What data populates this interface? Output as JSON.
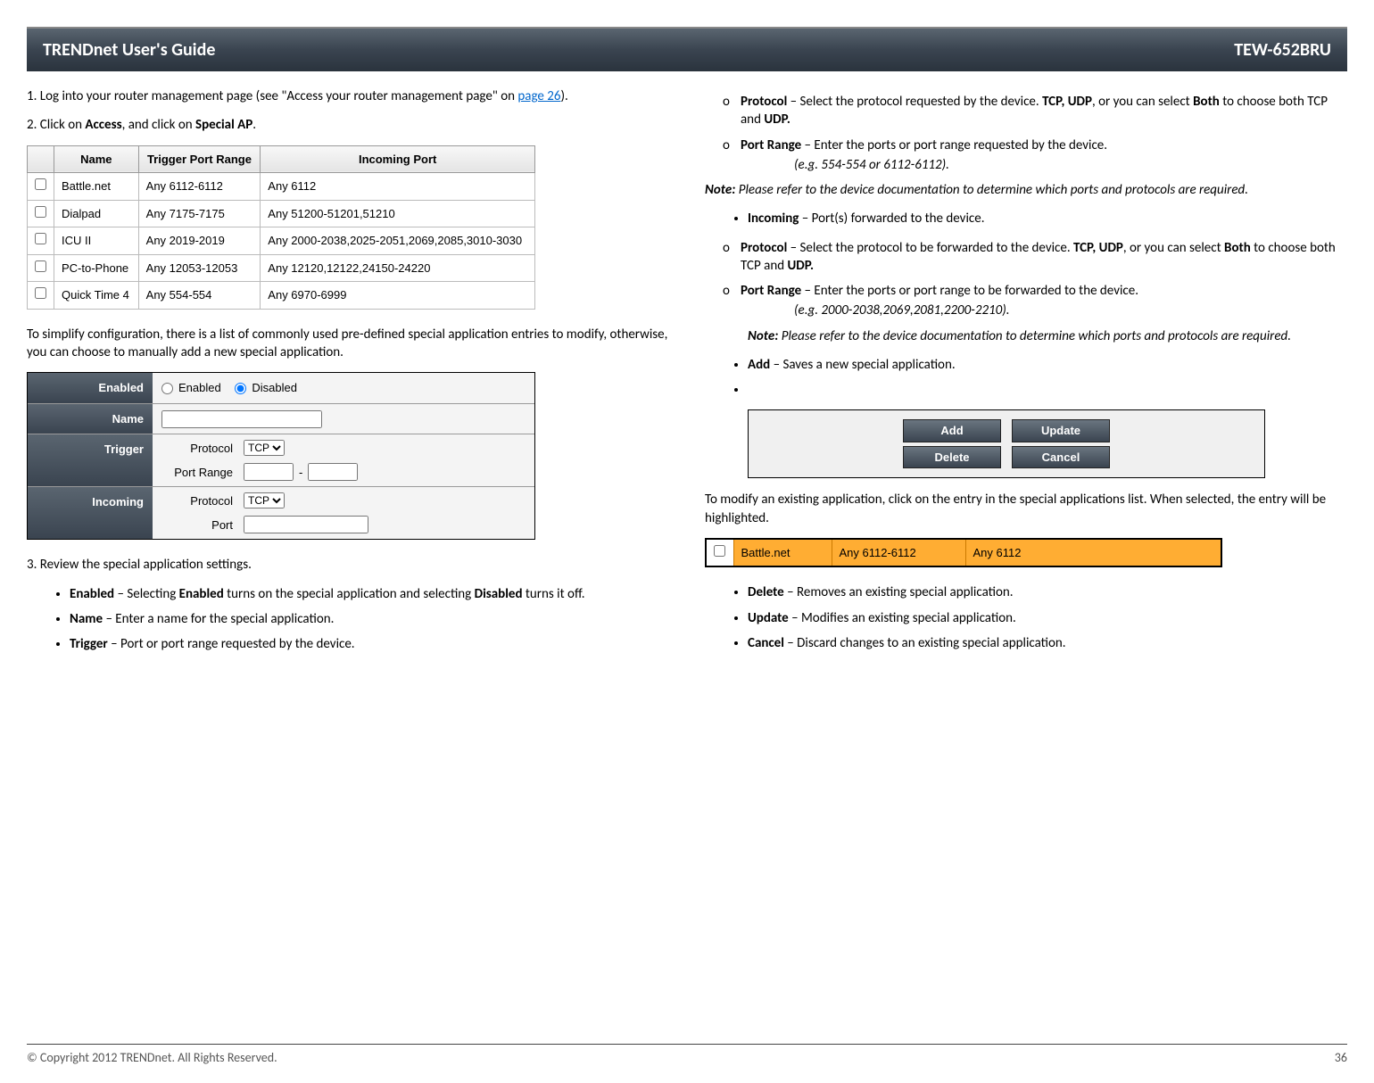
{
  "header": {
    "title": "TRENDnet User's Guide",
    "model": "TEW-652BRU"
  },
  "left": {
    "step1_a": "1. Log into your router management page (see \"Access your router management page\" on ",
    "step1_link": "page 26",
    "step1_b": ").",
    "step2_a": "2. Click on ",
    "step2_b1": "Access",
    "step2_c": ", and click on ",
    "step2_b2": "Special AP",
    "step2_d": ".",
    "apps_headers": {
      "name": "Name",
      "trigger": "Trigger Port Range",
      "incoming": "Incoming Port"
    },
    "apps": [
      {
        "name": "Battle.net",
        "trigger": "Any 6112-6112",
        "incoming": "Any 6112"
      },
      {
        "name": "Dialpad",
        "trigger": "Any 7175-7175",
        "incoming": "Any 51200-51201,51210"
      },
      {
        "name": "ICU II",
        "trigger": "Any 2019-2019",
        "incoming": "Any 2000-2038,2025-2051,2069,2085,3010-3030"
      },
      {
        "name": "PC-to-Phone",
        "trigger": "Any 12053-12053",
        "incoming": "Any 12120,12122,24150-24220"
      },
      {
        "name": "Quick Time 4",
        "trigger": "Any 554-554",
        "incoming": "Any 6970-6999"
      }
    ],
    "simplify": "To simplify configuration, there is a list of commonly used pre-defined special application entries to modify, otherwise, you can choose to manually add a new special application.",
    "form": {
      "enabled_label": "Enabled",
      "radio_enabled": "Enabled",
      "radio_disabled": "Disabled",
      "name_label": "Name",
      "trigger_label": "Trigger",
      "incoming_label": "Incoming",
      "protocol_label": "Protocol",
      "portrange_label": "Port Range",
      "port_label": "Port",
      "proto_opt": "TCP"
    },
    "step3": "3. Review the special application settings.",
    "b_enabled_t": "Enabled",
    "b_enabled_a": " – Selecting ",
    "b_enabled_b1": "Enabled",
    "b_enabled_c": " turns on the special application and selecting ",
    "b_enabled_b2": "Disabled",
    "b_enabled_d": " turns it off.",
    "b_name_t": "Name",
    "b_name_txt": " – Enter a name for the special application.",
    "b_trigger_t": "Trigger",
    "b_trigger_txt": " – Port or port range requested by the device."
  },
  "right": {
    "s_proto_t": "Protocol",
    "s_proto_a": " – Select the protocol requested by the device. ",
    "s_proto_b1": "TCP, UDP",
    "s_proto_c": ", or you can select ",
    "s_proto_b2": "Both",
    "s_proto_d": " to choose both TCP and ",
    "s_proto_b3": "UDP.",
    "s_pr_t": "Port Range",
    "s_pr_txt": " – Enter the ports or port range requested by the device.",
    "s_pr_eg": "(e.g. 554-554 or 6112-6112).",
    "note1_l": "Note:",
    "note1_t": " Please refer to the device documentation to determine which ports and protocols are required.",
    "b_in_t": "Incoming",
    "b_in_txt": " – Port(s) forwarded to the device.",
    "s2_proto_t": "Protocol",
    "s2_proto_a": " – Select the protocol to be forwarded to the device. ",
    "s2_proto_b1": "TCP, UDP",
    "s2_proto_c": ", or you can select ",
    "s2_proto_b2": "Both",
    "s2_proto_d": " to choose both TCP and ",
    "s2_proto_b3": "UDP.",
    "s2_pr_t": "Port Range",
    "s2_pr_txt": " – Enter the ports or port range to be forwarded to the device.",
    "s2_pr_eg": "(e.g. 2000-2038,2069,2081,2200-2210).",
    "note2_l": "Note:",
    "note2_t": " Please refer to the device documentation to determine which ports and protocols are required.",
    "b_add_t": "Add",
    "b_add_txt": " – Saves a new special application.",
    "btns": {
      "add": "Add",
      "update": "Update",
      "delete": "Delete",
      "cancel": "Cancel"
    },
    "modify": "To modify an existing application, click on the entry in the special applications list. When selected, the entry will be highlighted.",
    "sel": {
      "name": "Battle.net",
      "trigger": "Any 6112-6112",
      "incoming": "Any 6112"
    },
    "b_del_t": "Delete",
    "b_del_txt": " – Removes an existing special application.",
    "b_upd_t": "Update",
    "b_upd_txt": " – Modifies an existing special application.",
    "b_can_t": "Cancel",
    "b_can_txt": " – Discard changes to an existing special application."
  },
  "footer": {
    "copyright": "© Copyright 2012 TRENDnet. All Rights Reserved.",
    "page": "36"
  }
}
